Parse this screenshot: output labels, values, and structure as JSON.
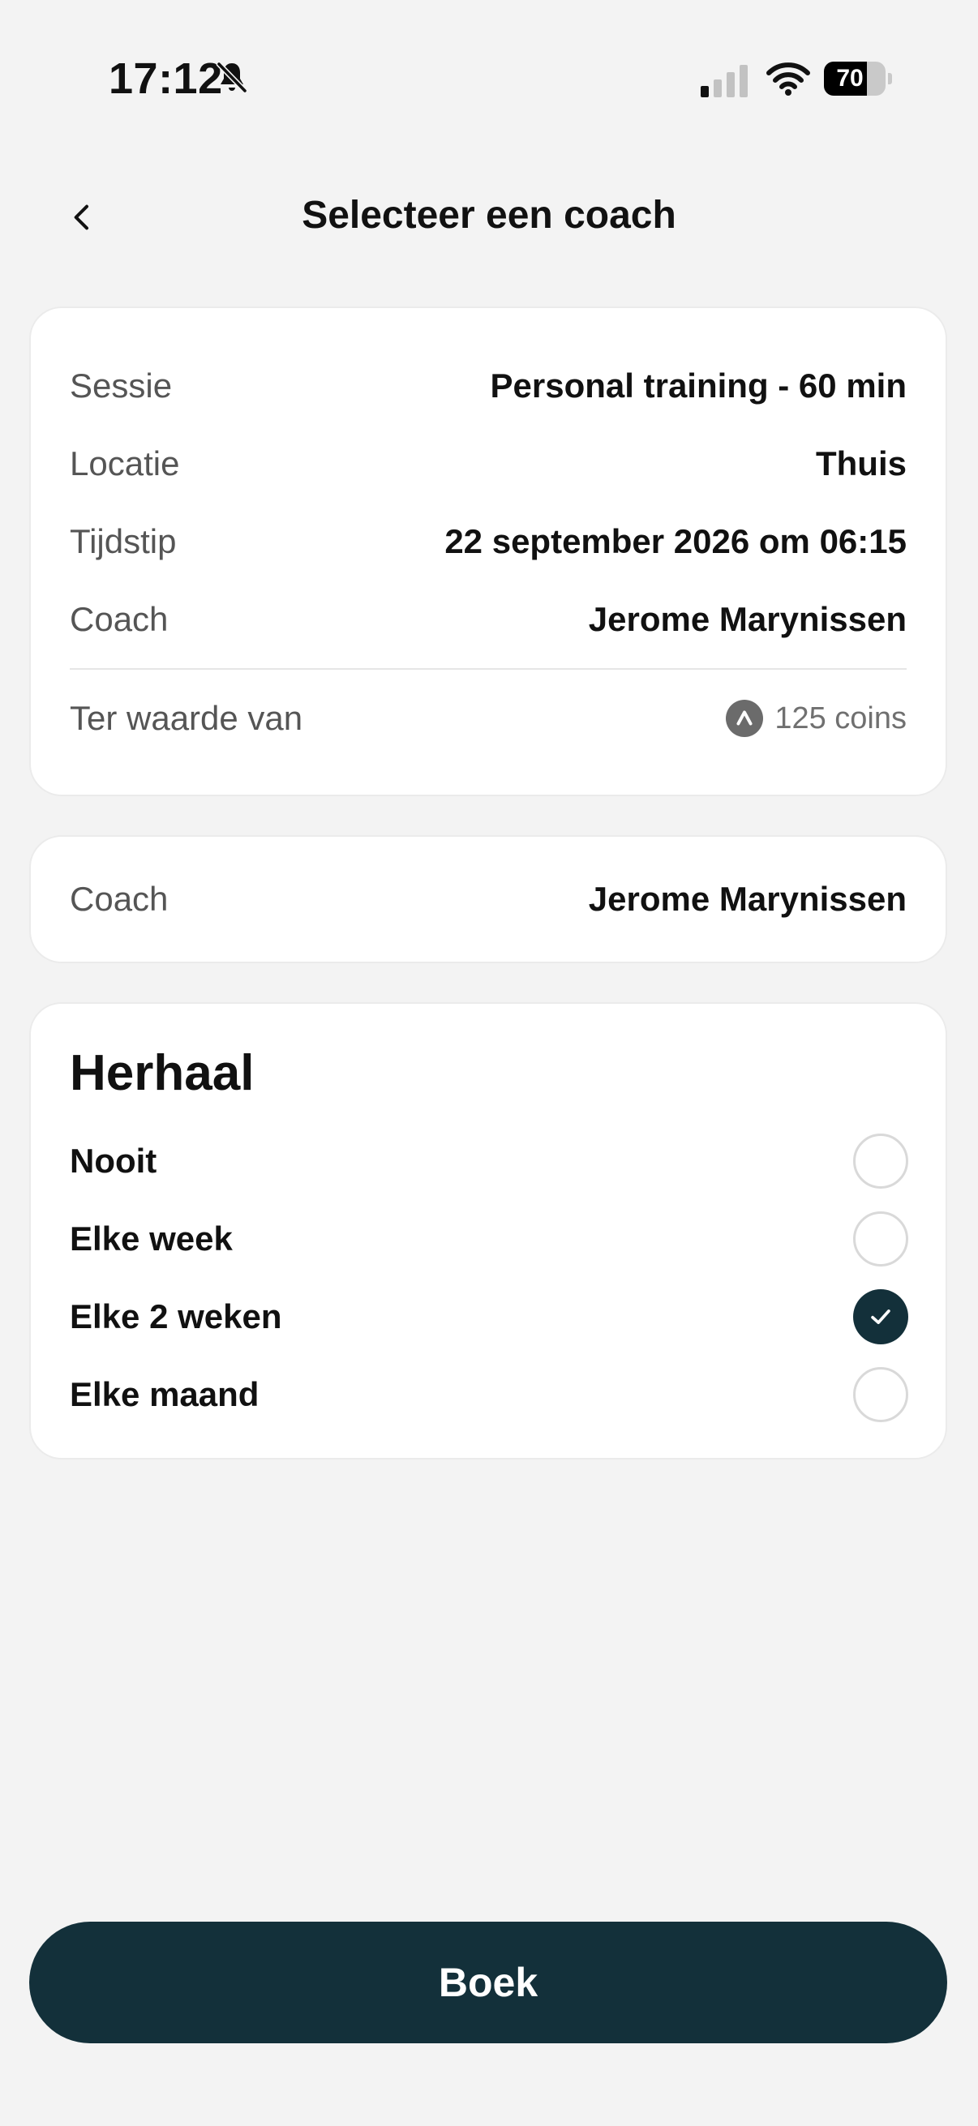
{
  "status_bar": {
    "time": "17:12",
    "battery_level": "70",
    "battery_fraction": 0.7,
    "icons": [
      "bell-slash-icon",
      "cellular-signal-icon",
      "wifi-icon",
      "battery-icon"
    ]
  },
  "header": {
    "title": "Selecteer een coach",
    "back_icon": "chevron-left-icon"
  },
  "details": {
    "rows": [
      {
        "label": "Sessie",
        "value": "Personal training - 60 min"
      },
      {
        "label": "Locatie",
        "value": "Thuis"
      },
      {
        "label": "Tijdstip",
        "value": "22 september 2026 om 06:15"
      },
      {
        "label": "Coach",
        "value": "Jerome Marynissen"
      }
    ],
    "worth_label": "Ter waarde van",
    "worth_value": "125 coins",
    "coin_icon": "coin-icon"
  },
  "coach_select": {
    "label": "Coach",
    "value": "Jerome Marynissen"
  },
  "repeat": {
    "title": "Herhaal",
    "options": [
      {
        "label": "Nooit",
        "selected": false
      },
      {
        "label": "Elke week",
        "selected": false
      },
      {
        "label": "Elke 2 weken",
        "selected": true
      },
      {
        "label": "Elke maand",
        "selected": false
      }
    ]
  },
  "book_button": {
    "label": "Boek"
  },
  "colors": {
    "background": "#f3f3f3",
    "card": "#ffffff",
    "primary": "#13303a",
    "muted_text": "#555555"
  }
}
